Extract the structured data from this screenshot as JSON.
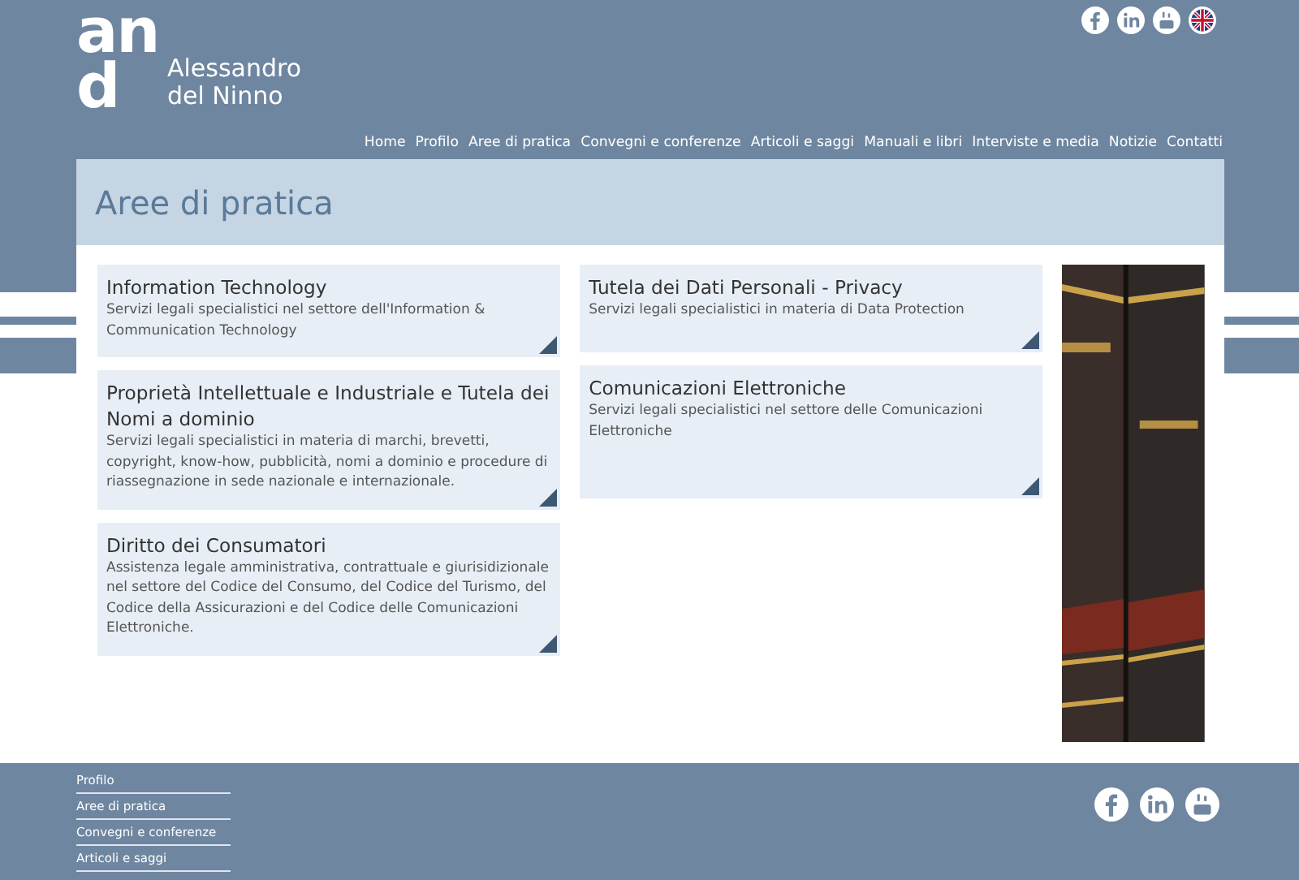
{
  "logo": {
    "mark": "and",
    "name_line_1": "Alessandro",
    "name_line_2": "del Ninno"
  },
  "social": [
    {
      "kind": "facebook"
    },
    {
      "kind": "linkedin"
    },
    {
      "kind": "youtube"
    },
    {
      "kind": "flag"
    }
  ],
  "nav": [
    {
      "label": "Home"
    },
    {
      "label": "Profilo"
    },
    {
      "label": "Aree di pratica"
    },
    {
      "label": "Convegni e conferenze"
    },
    {
      "label": "Articoli e saggi"
    },
    {
      "label": "Manuali e libri"
    },
    {
      "label": "Interviste e media"
    },
    {
      "label": "Notizie"
    },
    {
      "label": "Contatti"
    }
  ],
  "page_title": "Aree di pratica",
  "columns": [
    [
      {
        "title": "Information Technology",
        "text": "Servizi legali specialistici nel settore dell'Information & Communication Technology"
      },
      {
        "title": "Proprietà Intellettuale e Industriale e Tutela dei Nomi a dominio",
        "text": "Servizi legali specialistici in materia di marchi, brevetti, copyright, know-how, pubblicità, nomi a dominio e procedure di riassegnazione in sede nazionale e internazionale."
      },
      {
        "title": "Diritto dei Consumatori",
        "text": "Assistenza legale amministrativa, contrattuale e giurisidizionale nel settore del Codice del Consumo, del Codice del Turismo, del Codice della Assicurazioni e del Codice delle Comunicazioni Elettroniche."
      }
    ],
    [
      {
        "title": "Tutela dei Dati Personali - Privacy",
        "text": "Servizi legali specialistici in materia di Data Protection"
      },
      {
        "title": "Comunicazioni Elettroniche",
        "text": "Servizi legali specialistici nel settore delle Comunicazioni Elettroniche"
      }
    ]
  ],
  "side_image": {
    "kind": "picture"
  },
  "footer": {
    "links": [
      {
        "label": "Profilo"
      },
      {
        "label": "Aree di pratica"
      },
      {
        "label": "Convegni e conferenze"
      },
      {
        "label": "Articoli e saggi"
      }
    ],
    "social": [
      {
        "kind": "facebook"
      },
      {
        "kind": "linkedin"
      },
      {
        "kind": "youtube"
      }
    ]
  }
}
